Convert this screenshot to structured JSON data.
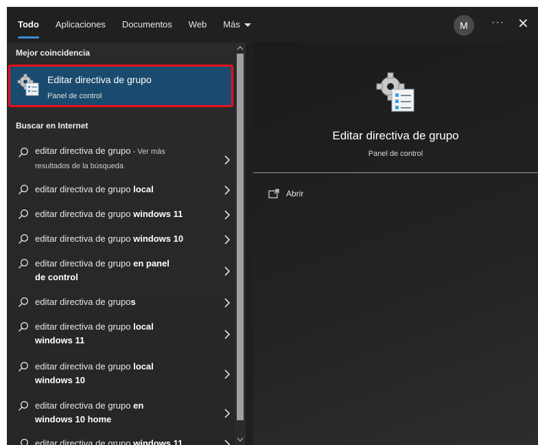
{
  "tabs": [
    {
      "label": "Todo",
      "active": true
    },
    {
      "label": "Aplicaciones"
    },
    {
      "label": "Documentos"
    },
    {
      "label": "Web"
    },
    {
      "label": "Más"
    }
  ],
  "header": {
    "avatar_initial": "M",
    "more_options": "···",
    "close": "✕"
  },
  "best_match": {
    "section_label": "Mejor coincidencia",
    "title": "Editar directiva de grupo",
    "subtitle": "Panel de control",
    "icon": "group-policy-icon"
  },
  "web_section": {
    "label": "Buscar en Internet",
    "results": [
      {
        "query": "editar directiva de grupo",
        "suffix": " - Ver más",
        "line2": "resultados de la búsqueda"
      },
      {
        "query": "editar directiva de grupo ",
        "bold": "local"
      },
      {
        "query": "editar directiva de grupo ",
        "bold": "windows 11"
      },
      {
        "query": "editar directiva de grupo ",
        "bold": "windows 10"
      },
      {
        "query": "editar directiva de grupo ",
        "bold": "en panel",
        "line2_bold": "de control"
      },
      {
        "query": "editar directiva de grupo",
        "bold": "s"
      },
      {
        "query": "editar directiva de grupo ",
        "bold": "local",
        "line2_bold": "windows 11"
      },
      {
        "query": "editar directiva de grupo ",
        "bold": "local",
        "line2_bold": "windows 10"
      },
      {
        "query": "editar directiva de grupo ",
        "bold": "en",
        "line2_bold": "windows 10 home"
      },
      {
        "query": "editar directiva de grupo ",
        "bold": "windows 11"
      }
    ]
  },
  "preview": {
    "title": "Editar directiva de grupo",
    "subtitle": "Panel de control",
    "actions": [
      {
        "label": "Abrir",
        "icon": "open-window-icon"
      }
    ]
  },
  "colors": {
    "accent": "#3d8fd8",
    "selection": "#1a4b6e",
    "highlight_border": "#e8101c"
  }
}
